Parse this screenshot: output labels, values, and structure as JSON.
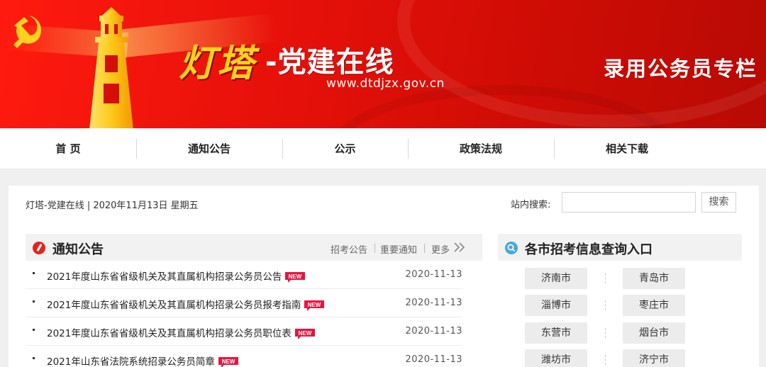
{
  "banner": {
    "title_main": "灯塔",
    "title_rest": "-党建在线",
    "url": "www.dtdjzx.gov.cn",
    "column_title": "录用公务员专栏",
    "colors": {
      "red": "#e8110a",
      "gold": "#ffd21f"
    },
    "icons": [
      "party-emblem-icon",
      "lighthouse-icon"
    ]
  },
  "nav": {
    "items": [
      {
        "label": "首 页"
      },
      {
        "label": "通知公告"
      },
      {
        "label": "公示"
      },
      {
        "label": "政策法规"
      },
      {
        "label": "相关下载"
      }
    ]
  },
  "topbar": {
    "date_line": "灯塔-党建在线 | 2020年11月13日 星期五",
    "search_label": "站内搜索:",
    "search_value": "",
    "search_button": "搜索"
  },
  "notices": {
    "title": "通知公告",
    "links": [
      "招考公告",
      "重要通知",
      "更多"
    ],
    "badge_text": "NEW",
    "items": [
      {
        "title": "2021年度山东省省级机关及其直属机构招录公务员公告",
        "date": "2020-11-13",
        "is_new": true
      },
      {
        "title": "2021年度山东省省级机关及其直属机构招录公务员报考指南",
        "date": "2020-11-13",
        "is_new": true
      },
      {
        "title": "2021年度山东省省级机关及其直属机构招录公务员职位表",
        "date": "2020-11-13",
        "is_new": true
      },
      {
        "title": "2021年山东省法院系统招录公务员简章",
        "date": "2020-11-13",
        "is_new": true
      }
    ]
  },
  "cities": {
    "title": "各市招考信息查询入口",
    "items": [
      "济南市",
      "青岛市",
      "淄博市",
      "枣庄市",
      "东营市",
      "烟台市",
      "潍坊市",
      "济宁市"
    ]
  }
}
